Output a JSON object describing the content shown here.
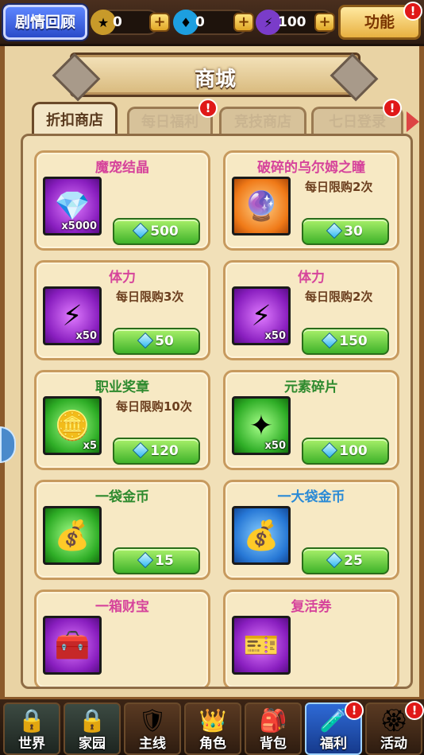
{
  "topbar": {
    "story_button": "剧情回顾",
    "resources": [
      {
        "icon": "star-coin-icon",
        "value": "0"
      },
      {
        "icon": "diamond-icon",
        "value": "0"
      },
      {
        "icon": "lightning-icon",
        "value": "100"
      }
    ],
    "function_button": "功能",
    "alert_mark": "!"
  },
  "shop": {
    "title": "商城",
    "tabs": [
      {
        "label": "折扣商店",
        "active": true,
        "alert": false
      },
      {
        "label": "每日福利",
        "active": false,
        "alert": true
      },
      {
        "label": "竞技商店",
        "active": false,
        "alert": false
      },
      {
        "label": "七日登录",
        "active": false,
        "alert": true
      }
    ],
    "items": [
      {
        "name": "魔宠结晶",
        "name_color": "#d6449b",
        "frame": "purple",
        "icon": "crystal-icon",
        "glyph": "💎",
        "qty": "x5000",
        "limit": "",
        "price": "500"
      },
      {
        "name": "破碎的乌尔姆之瞳",
        "name_color": "#d6449b",
        "frame": "orange",
        "icon": "eye-orb-icon",
        "glyph": "🔮",
        "qty": "",
        "limit": "每日限购2次",
        "price": "30"
      },
      {
        "name": "体力",
        "name_color": "#d6449b",
        "frame": "purple",
        "icon": "stamina-icon",
        "glyph": "⚡",
        "qty": "x50",
        "limit": "每日限购3次",
        "price": "50"
      },
      {
        "name": "体力",
        "name_color": "#d6449b",
        "frame": "purple",
        "icon": "stamina-icon",
        "glyph": "⚡",
        "qty": "x50",
        "limit": "每日限购2次",
        "price": "150"
      },
      {
        "name": "职业奖章",
        "name_color": "#2e8a2e",
        "frame": "green",
        "icon": "medal-icon",
        "glyph": "🪙",
        "qty": "x5",
        "limit": "每日限购10次",
        "price": "120"
      },
      {
        "name": "元素碎片",
        "name_color": "#2e8a2e",
        "frame": "green",
        "icon": "element-shard-icon",
        "glyph": "✦",
        "qty": "x50",
        "limit": "",
        "price": "100"
      },
      {
        "name": "一袋金币",
        "name_color": "#2e8a2e",
        "frame": "green",
        "icon": "gold-bag-icon",
        "glyph": "💰",
        "qty": "",
        "limit": "",
        "price": "15"
      },
      {
        "name": "一大袋金币",
        "name_color": "#2a8ad6",
        "frame": "blue",
        "icon": "big-gold-bag-icon",
        "glyph": "💰",
        "qty": "",
        "limit": "",
        "price": "25"
      },
      {
        "name": "一箱财宝",
        "name_color": "#d6449b",
        "frame": "purple",
        "icon": "treasure-chest-icon",
        "glyph": "🧰",
        "qty": "",
        "limit": "",
        "price": ""
      },
      {
        "name": "复活券",
        "name_color": "#d6449b",
        "frame": "purple",
        "icon": "revive-ticket-icon",
        "glyph": "🎫",
        "qty": "",
        "limit": "",
        "price": ""
      }
    ]
  },
  "nav": {
    "items": [
      {
        "label": "世界",
        "icon": "world-icon",
        "glyph": "🔒",
        "state": "locked",
        "alert": false
      },
      {
        "label": "家园",
        "icon": "home-icon",
        "glyph": "🔒",
        "state": "locked",
        "alert": false
      },
      {
        "label": "主线",
        "icon": "main-quest-icon",
        "glyph": "🛡",
        "state": "normal",
        "alert": false
      },
      {
        "label": "角色",
        "icon": "character-icon",
        "glyph": "👑",
        "state": "normal",
        "alert": false
      },
      {
        "label": "背包",
        "icon": "backpack-icon",
        "glyph": "🎒",
        "state": "normal",
        "alert": false
      },
      {
        "label": "福利",
        "icon": "welfare-icon",
        "glyph": "🧪",
        "state": "active",
        "alert": true
      },
      {
        "label": "活动",
        "icon": "event-icon",
        "glyph": "🏵",
        "state": "normal",
        "alert": true
      }
    ]
  }
}
